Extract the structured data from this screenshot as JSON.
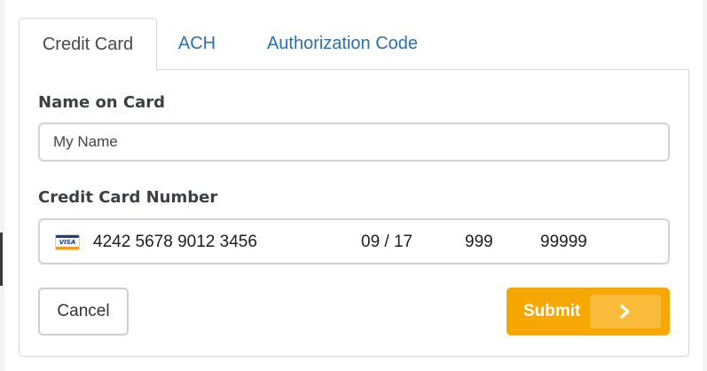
{
  "tabs": [
    {
      "label": "Credit Card",
      "active": true
    },
    {
      "label": "ACH",
      "active": false
    },
    {
      "label": "Authorization Code",
      "active": false
    }
  ],
  "form": {
    "name_label": "Name on Card",
    "name_value": "My Name",
    "card_label": "Credit Card Number",
    "card_brand_icon": "visa-card-icon",
    "card_brand_text": "VISA",
    "card_number": "4242 5678 9012 3456",
    "expiry": "09 / 17",
    "cvc": "999",
    "zip": "99999"
  },
  "actions": {
    "cancel_label": "Cancel",
    "submit_label": "Submit",
    "submit_icon": "chevron-right-icon"
  },
  "colors": {
    "tab_link": "#2a6fb0",
    "submit_bg": "#f7a800",
    "submit_arrow_bg": "#f9bb3a",
    "border": "#d6d6d6"
  }
}
